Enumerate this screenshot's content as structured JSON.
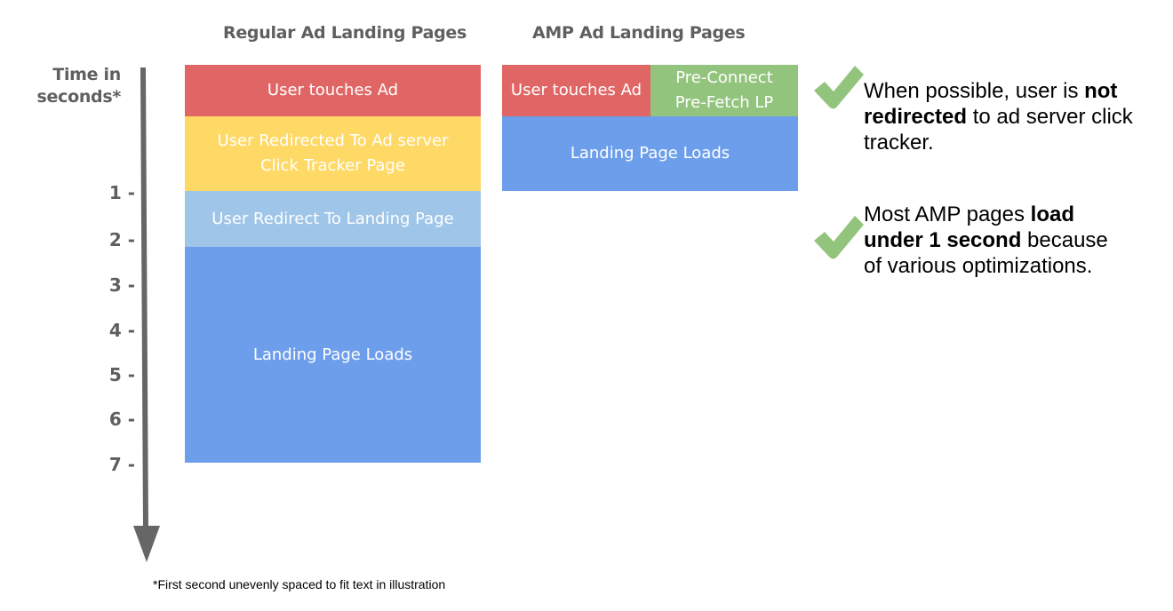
{
  "columns": {
    "regular": {
      "title": "Regular Ad Landing Pages",
      "blocks": [
        {
          "label": "User touches Ad",
          "color": "#e06666"
        },
        {
          "label": "User Redirected To Ad server Click Tracker Page",
          "color": "#ffd966"
        },
        {
          "label": "User Redirect To Landing Page",
          "color": "#9fc5e8"
        },
        {
          "label": "Landing Page Loads",
          "color": "#6d9eeb"
        }
      ]
    },
    "amp": {
      "title": "AMP Ad Landing Pages",
      "blocks": [
        {
          "label": "User touches Ad",
          "color": "#e06666"
        },
        {
          "label": "Pre-Connect Pre-Fetch LP",
          "color": "#93c47d"
        },
        {
          "label": "Landing Page Loads",
          "color": "#6d9eeb"
        }
      ]
    }
  },
  "axis": {
    "title_line1": "Time in",
    "title_line2": "seconds*",
    "ticks": [
      "1 -",
      "2 -",
      "3 -",
      "4 -",
      "5 -",
      "6 -",
      "7 -"
    ],
    "color": "#666666"
  },
  "notes": [
    {
      "pre": "When possible, user is ",
      "bold": "not redirected",
      "post": " to ad server click tracker."
    },
    {
      "pre": "Most AMP pages ",
      "bold": "load under 1 second",
      "post": " because of various optimizations."
    }
  ],
  "check_color": "#93c47d",
  "footnote": "*First second unevenly spaced to fit text in illustration"
}
